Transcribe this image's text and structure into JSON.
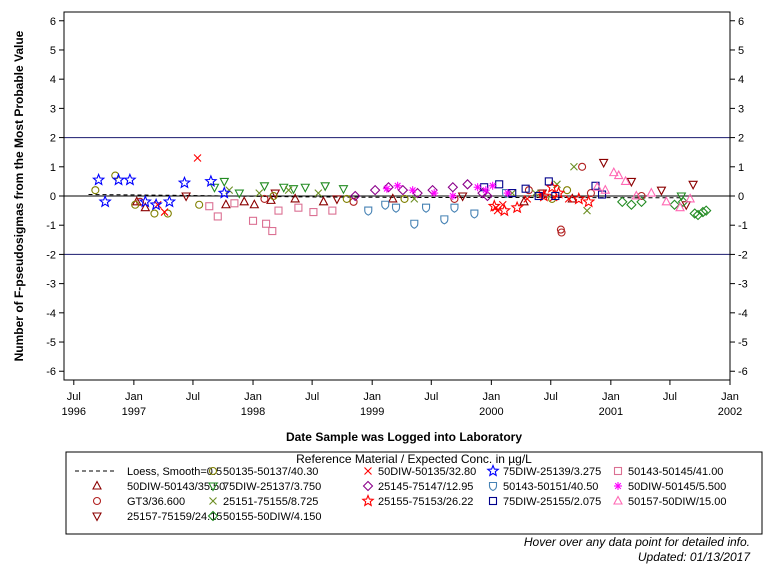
{
  "chart_data": {
    "type": "scatter",
    "xlabel": "Date Sample was Logged into Laboratory",
    "ylabel": "Number of F-pseudosigmas from the Most Probable Value",
    "x_range": [
      "1996-06-01",
      "2002-01-01"
    ],
    "ylim": [
      -6.3,
      6.3
    ],
    "y_ticks": [
      -6,
      -5,
      -4,
      -3,
      -2,
      -1,
      0,
      1,
      2,
      3,
      4,
      5,
      6
    ],
    "x_ticks": [
      {
        "date": "1996-07-01",
        "line1": "Jul",
        "line2": "1996"
      },
      {
        "date": "1997-01-01",
        "line1": "Jan",
        "line2": "1997"
      },
      {
        "date": "1997-07-01",
        "line1": "Jul",
        "line2": ""
      },
      {
        "date": "1998-01-01",
        "line1": "Jan",
        "line2": "1998"
      },
      {
        "date": "1998-07-01",
        "line1": "Jul",
        "line2": ""
      },
      {
        "date": "1999-01-01",
        "line1": "Jan",
        "line2": "1999"
      },
      {
        "date": "1999-07-01",
        "line1": "Jul",
        "line2": ""
      },
      {
        "date": "2000-01-01",
        "line1": "Jan",
        "line2": "2000"
      },
      {
        "date": "2000-07-01",
        "line1": "Jul",
        "line2": ""
      },
      {
        "date": "2001-01-01",
        "line1": "Jan",
        "line2": "2001"
      },
      {
        "date": "2001-07-01",
        "line1": "Jul",
        "line2": ""
      },
      {
        "date": "2002-01-01",
        "line1": "Jan",
        "line2": "2002"
      }
    ],
    "reference_lines": [
      {
        "y": 2,
        "color": "#1a1a6e"
      },
      {
        "y": 0,
        "color": "#000000"
      },
      {
        "y": -2,
        "color": "#1a1a6e"
      }
    ],
    "legend_title": "Reference Material / Expected Conc. in µg/L",
    "legend_position": "bottom",
    "loess": {
      "name": "Loess, Smooth=0.5",
      "color": "#000000",
      "points": [
        [
          "1996-08-15",
          0.05
        ],
        [
          "1997-06-01",
          0.02
        ],
        [
          "1998-06-01",
          -0.03
        ],
        [
          "1999-06-01",
          -0.05
        ],
        [
          "2000-06-01",
          -0.05
        ],
        [
          "2001-08-01",
          -0.06
        ]
      ]
    },
    "series": [
      {
        "name": "50DIW-50143/35.50",
        "marker": "triangle",
        "color": "#8b0000",
        "points": [
          [
            "1997-01-10",
            -0.2
          ],
          [
            "1997-02-05",
            -0.4
          ],
          [
            "1997-10-10",
            -0.3
          ],
          [
            "1997-12-05",
            -0.2
          ],
          [
            "1998-01-05",
            -0.3
          ],
          [
            "1998-02-25",
            -0.15
          ],
          [
            "1998-05-10",
            -0.1
          ],
          [
            "1998-08-05",
            -0.2
          ],
          [
            "1999-03-05",
            -0.1
          ],
          [
            "2000-04-10",
            -0.2
          ],
          [
            "2000-09-05",
            -0.1
          ]
        ]
      },
      {
        "name": "GT3/36.600",
        "marker": "circle",
        "color": "#b22222",
        "points": [
          [
            "1997-01-20",
            -0.2
          ],
          [
            "1998-02-05",
            -0.1
          ],
          [
            "1998-11-05",
            -0.2
          ],
          [
            "1999-09-10",
            -0.1
          ],
          [
            "2000-04-25",
            0.2
          ],
          [
            "2000-08-01",
            -1.15
          ],
          [
            "2000-08-03",
            -1.25
          ],
          [
            "2000-10-05",
            1.0
          ],
          [
            "2000-11-01",
            0.1
          ],
          [
            "2001-04-05",
            0.0
          ]
        ]
      },
      {
        "name": "25157-75159/24.15",
        "marker": "triangle-down",
        "color": "#8b0000",
        "points": [
          [
            "1997-06-10",
            0.0
          ],
          [
            "1998-03-10",
            0.1
          ],
          [
            "1998-09-15",
            -0.1
          ],
          [
            "1999-10-05",
            0.0
          ],
          [
            "2000-06-05",
            0.1
          ],
          [
            "2000-12-10",
            1.15
          ],
          [
            "2001-03-05",
            0.5
          ],
          [
            "2001-06-05",
            0.2
          ],
          [
            "2001-09-10",
            0.4
          ],
          [
            "2001-08-20",
            -0.3
          ]
        ]
      },
      {
        "name": "50135-50137/40.30",
        "marker": "circle",
        "color": "#808000",
        "points": [
          [
            "1996-09-05",
            0.2
          ],
          [
            "1996-11-05",
            0.7
          ],
          [
            "1997-01-05",
            -0.3
          ],
          [
            "1997-03-05",
            -0.6
          ],
          [
            "1997-04-15",
            -0.6
          ],
          [
            "1997-07-20",
            -0.3
          ],
          [
            "1998-03-05",
            0.0
          ],
          [
            "1998-10-15",
            -0.1
          ],
          [
            "1999-04-10",
            -0.1
          ],
          [
            "2000-07-05",
            -0.1
          ],
          [
            "2000-08-20",
            0.2
          ]
        ]
      },
      {
        "name": "75DIW-25137/3.750",
        "marker": "triangle-down",
        "color": "#228b22",
        "points": [
          [
            "1997-09-05",
            0.3
          ],
          [
            "1997-10-05",
            0.5
          ],
          [
            "1997-11-20",
            0.1
          ],
          [
            "1998-02-05",
            0.35
          ],
          [
            "1998-04-05",
            0.3
          ],
          [
            "1998-05-05",
            0.25
          ],
          [
            "1998-06-10",
            0.3
          ],
          [
            "1998-08-10",
            0.35
          ],
          [
            "1998-10-05",
            0.25
          ],
          [
            "2001-08-05",
            0.0
          ]
        ]
      },
      {
        "name": "25151-75155/8.725",
        "marker": "x",
        "color": "#6b8e23",
        "points": [
          [
            "1997-10-20",
            0.2
          ],
          [
            "1998-01-20",
            0.1
          ],
          [
            "1998-04-20",
            0.2
          ],
          [
            "1998-07-20",
            0.1
          ],
          [
            "1999-05-10",
            -0.1
          ],
          [
            "2000-03-05",
            0.1
          ],
          [
            "2000-05-15",
            0.1
          ],
          [
            "2000-09-10",
            1.0
          ],
          [
            "2000-07-20",
            0.4
          ],
          [
            "2000-10-20",
            -0.5
          ]
        ]
      },
      {
        "name": "50DIW-50135/32.80",
        "marker": "x",
        "color": "#ff0000",
        "points": [
          [
            "1997-03-15",
            -0.3
          ],
          [
            "1997-07-15",
            1.3
          ],
          [
            "1997-04-05",
            -0.55
          ],
          [
            "2000-01-15",
            -0.4
          ],
          [
            "2000-01-20",
            -0.5
          ],
          [
            "2000-02-05",
            -0.3
          ],
          [
            "2000-04-20",
            -0.1
          ],
          [
            "2000-06-05",
            0.05
          ],
          [
            "2000-07-10",
            -0.05
          ],
          [
            "2000-08-25",
            -0.1
          ]
        ]
      },
      {
        "name": "25145-75147/12.95",
        "marker": "diamond",
        "color": "#8b008b",
        "points": [
          [
            "1998-11-10",
            0.0
          ],
          [
            "1999-01-10",
            0.2
          ],
          [
            "1999-02-20",
            0.3
          ],
          [
            "1999-04-05",
            0.2
          ],
          [
            "1999-05-20",
            0.1
          ],
          [
            "1999-07-05",
            0.2
          ],
          [
            "1999-09-05",
            0.3
          ],
          [
            "1999-10-20",
            0.4
          ],
          [
            "1999-12-05",
            0.1
          ],
          [
            "1999-12-20",
            0.0
          ]
        ]
      },
      {
        "name": "50155-50DIW/4.150",
        "marker": "diamond",
        "color": "#228b22",
        "points": [
          [
            "2001-02-05",
            -0.2
          ],
          [
            "2001-03-05",
            -0.3
          ],
          [
            "2001-04-05",
            -0.2
          ],
          [
            "2001-07-15",
            -0.3
          ],
          [
            "2001-09-15",
            -0.6
          ],
          [
            "2001-10-10",
            -0.55
          ],
          [
            "2001-10-20",
            -0.5
          ],
          [
            "2001-09-25",
            -0.65
          ],
          [
            "2001-08-10",
            -0.2
          ]
        ]
      },
      {
        "name": "75DIW-25139/3.275",
        "marker": "star",
        "color": "#0000ff",
        "points": [
          [
            "1996-09-15",
            0.55
          ],
          [
            "1996-10-05",
            -0.2
          ],
          [
            "1996-11-15",
            0.55
          ],
          [
            "1996-12-20",
            0.55
          ],
          [
            "1997-02-05",
            -0.2
          ],
          [
            "1997-03-10",
            -0.3
          ],
          [
            "1997-04-20",
            -0.2
          ],
          [
            "1997-06-05",
            0.45
          ],
          [
            "1997-08-25",
            0.5
          ],
          [
            "1997-10-05",
            0.1
          ]
        ]
      },
      {
        "name": "25155-75153/26.22",
        "marker": "star",
        "color": "#ff0000",
        "points": [
          [
            "2000-01-10",
            -0.35
          ],
          [
            "2000-02-10",
            -0.5
          ],
          [
            "2000-03-20",
            -0.4
          ],
          [
            "2000-06-10",
            0.0
          ],
          [
            "2000-07-05",
            0.3
          ],
          [
            "2000-07-25",
            0.1
          ],
          [
            "2000-09-25",
            -0.1
          ],
          [
            "2000-10-25",
            -0.2
          ]
        ]
      },
      {
        "name": "50143-50151/40.50",
        "marker": "shield",
        "color": "#4682b4",
        "points": [
          [
            "1998-12-20",
            -0.5
          ],
          [
            "1999-02-10",
            -0.3
          ],
          [
            "1999-03-15",
            -0.4
          ],
          [
            "1999-05-10",
            -0.95
          ],
          [
            "1999-06-15",
            -0.4
          ],
          [
            "1999-08-10",
            -0.8
          ],
          [
            "1999-09-10",
            -0.4
          ],
          [
            "1999-11-10",
            -0.6
          ],
          [
            "2000-02-15",
            0.1
          ]
        ]
      },
      {
        "name": "75DIW-25155/2.075",
        "marker": "square",
        "color": "#00008b",
        "points": [
          [
            "1999-12-10",
            0.3
          ],
          [
            "2000-01-25",
            0.4
          ],
          [
            "2000-03-05",
            0.1
          ],
          [
            "2000-04-15",
            0.25
          ],
          [
            "2000-05-25",
            0.0
          ],
          [
            "2000-06-25",
            0.5
          ],
          [
            "2000-07-15",
            0.0
          ],
          [
            "2000-11-15",
            0.35
          ],
          [
            "2000-12-05",
            0.05
          ]
        ]
      },
      {
        "name": "50143-50145/41.00",
        "marker": "square",
        "color": "#db7093",
        "points": [
          [
            "1997-08-20",
            -0.35
          ],
          [
            "1997-09-15",
            -0.7
          ],
          [
            "1997-11-05",
            -0.25
          ],
          [
            "1998-01-01",
            -0.85
          ],
          [
            "1998-02-10",
            -0.95
          ],
          [
            "1998-03-01",
            -1.2
          ],
          [
            "1998-03-20",
            -0.5
          ],
          [
            "1998-05-20",
            -0.4
          ],
          [
            "1998-07-05",
            -0.55
          ],
          [
            "1998-09-01",
            -0.5
          ]
        ]
      },
      {
        "name": "50DIW-50145/5.500",
        "marker": "asterisk",
        "color": "#ff00ff",
        "points": [
          [
            "1999-02-15",
            0.25
          ],
          [
            "1999-03-20",
            0.35
          ],
          [
            "1999-05-05",
            0.2
          ],
          [
            "1999-07-10",
            0.1
          ],
          [
            "1999-09-05",
            0.0
          ],
          [
            "1999-11-20",
            0.3
          ],
          [
            "1999-12-15",
            0.2
          ],
          [
            "2000-01-05",
            0.35
          ],
          [
            "2000-02-20",
            0.1
          ]
        ]
      },
      {
        "name": "50157-50DIW/15.00",
        "marker": "triangle",
        "color": "#ff69b4",
        "points": [
          [
            "2000-11-20",
            0.3
          ],
          [
            "2000-12-15",
            0.2
          ],
          [
            "2001-01-10",
            0.8
          ],
          [
            "2001-01-25",
            0.7
          ],
          [
            "2001-02-15",
            0.5
          ],
          [
            "2001-03-20",
            0.0
          ],
          [
            "2001-05-05",
            0.1
          ],
          [
            "2001-06-20",
            -0.2
          ],
          [
            "2001-08-01",
            -0.4
          ],
          [
            "2001-09-01",
            -0.1
          ]
        ]
      }
    ]
  },
  "notes": {
    "hover": "Hover over any data point for detailed info.",
    "updated": "Updated: 01/13/2017"
  }
}
